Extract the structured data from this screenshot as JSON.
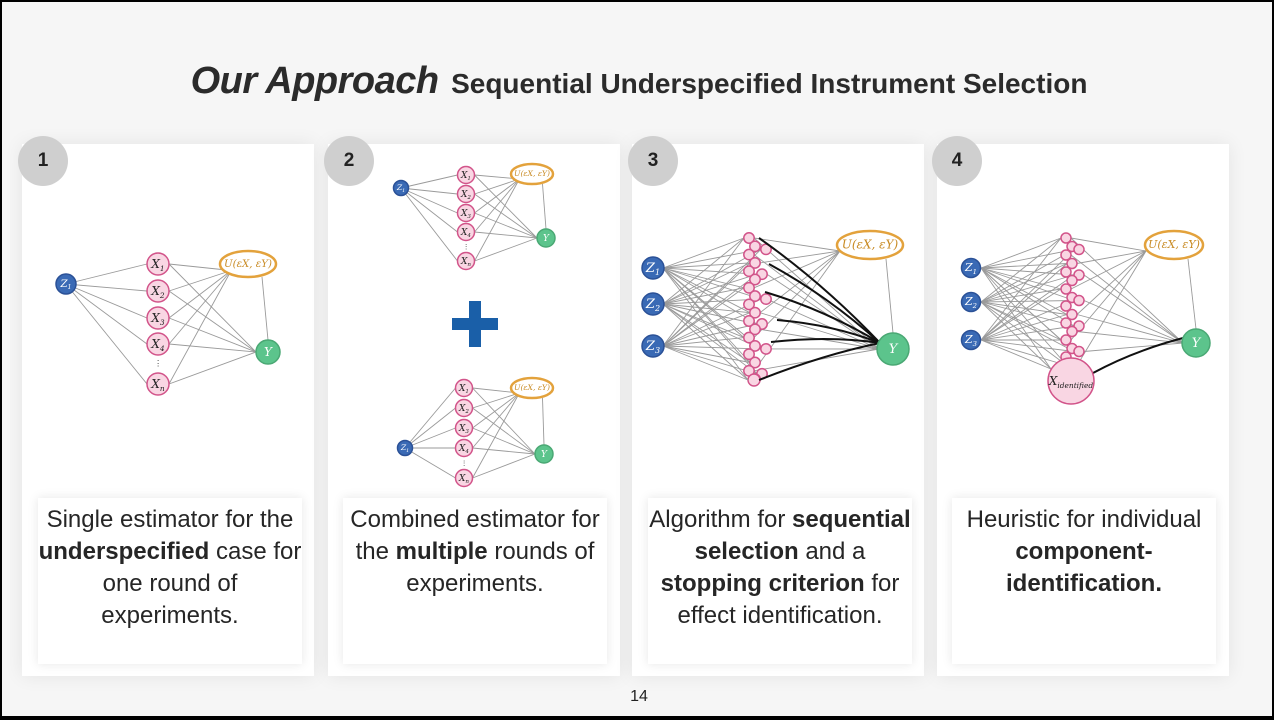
{
  "title": {
    "main": "Our Approach",
    "sub": "Sequential Underspecified Instrument Selection"
  },
  "steps": [
    {
      "number": "1",
      "caption_html": "Single estimator for the <b>underspecified</b> case for one round of experiments."
    },
    {
      "number": "2",
      "caption_html": "Combined estimator for the <b>multiple</b> rounds of experiments."
    },
    {
      "number": "3",
      "caption_html": "Algorithm for <b>sequential selection</b> and a <b>stopping criterion</b> for effect identification."
    },
    {
      "number": "4",
      "caption_html": "Heuristic for individual <b>component-identification.</b>"
    }
  ],
  "graph_labels": {
    "x_nodes": [
      "X1",
      "X2",
      "X3",
      "X4",
      "Xn"
    ],
    "u_node": "U(εX, εY)",
    "y_node": "Y",
    "x_identified": "Xidentified"
  },
  "plus_symbol": "+",
  "page_number": "14",
  "colors": {
    "z_node": "#3a6ab5",
    "x_node_fill": "#f9d6e3",
    "x_node_stroke": "#d2548a",
    "u_node": "#e3a23c",
    "y_node": "#5cc48c",
    "plus": "#1a5fa8"
  }
}
